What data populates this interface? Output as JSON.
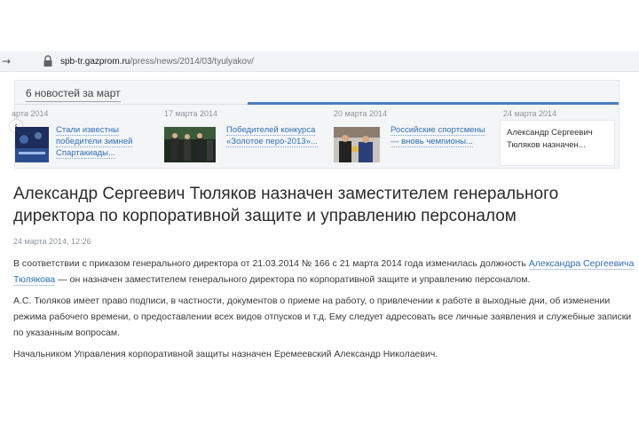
{
  "browser": {
    "nav_arrow": "→",
    "url_host": "spb-tr.gazprom.ru",
    "url_path": "/press/news/2014/03/tyulyakov/"
  },
  "news_strip": {
    "title": "6 новостей за март",
    "prev_arrow": "‹",
    "items": [
      {
        "date": "арта 2014",
        "link": "Стали известны победители зимней Спартакиады..."
      },
      {
        "date": "17 марта 2014",
        "link": "Победителей конкурса «Золотое перо-2013»..."
      },
      {
        "date": "20 марта 2014",
        "link": "Российские спортсмены — вновь чемпионы..."
      },
      {
        "date": "24 марта 2014",
        "active_text": "Александр Сергеевич Тюляков назначен..."
      }
    ]
  },
  "article": {
    "title": "Александр Сергеевич Тюляков назначен заместителем генерального директора по корпоративной защите и управлению персоналом",
    "date": "24 марта 2014, 12:26",
    "p1_before": "В соответствии с приказом генерального директора от 21.03.2014 № 166 с 21 марта 2014 года изменилась должность ",
    "p1_link": "Александра Сергеевича Тюлякова",
    "p1_after": " — он назначен заместителем генерального директора по корпоративной защите и управлению персоналом.",
    "p2": "А.С. Тюляков имеет право подписи, в частности, документов о приеме на работу, о привлечении к работе в выходные дни, об изменении режима рабочего времени, о предоставлении всех видов отпусков и т.д. Ему следует адресовать все личные заявления и служебные записки по указанным вопросам.",
    "p3": "Начальником Управления корпоративной защиты назначен Еремеевский Александр Николаевич."
  },
  "colors": {
    "link": "#2f6fb3",
    "progress": "#4a7fbf",
    "strip_bg": "#f4f5f7"
  }
}
